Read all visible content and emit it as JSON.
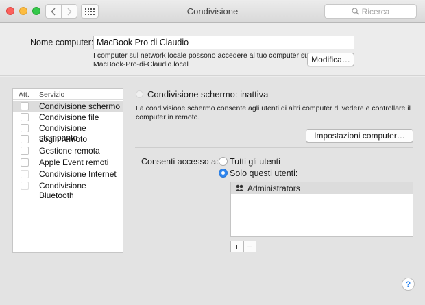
{
  "window": {
    "title": "Condivisione",
    "search_placeholder": "Ricerca"
  },
  "computer_name": {
    "label": "Nome computer:",
    "value": "MacBook Pro di Claudio",
    "info_line1": "I computer sul network locale possono accedere al tuo computer su:",
    "info_line2": "MacBook-Pro-di-Claudio.local",
    "edit_button": "Modifica…"
  },
  "services": {
    "col_on": "Att.",
    "col_service": "Servizio",
    "items": [
      {
        "label": "Condivisione schermo",
        "checked": false,
        "selected": true
      },
      {
        "label": "Condivisione file",
        "checked": false,
        "selected": false
      },
      {
        "label": "Condivisione stampante",
        "checked": false,
        "selected": false
      },
      {
        "label": "Login remoto",
        "checked": false,
        "selected": false
      },
      {
        "label": "Gestione remota",
        "checked": false,
        "selected": false
      },
      {
        "label": "Apple Event remoti",
        "checked": false,
        "selected": false
      },
      {
        "label": "Condivisione Internet",
        "checked": false,
        "selected": false
      },
      {
        "label": "Condivisione Bluetooth",
        "checked": false,
        "selected": false
      }
    ]
  },
  "detail": {
    "status_title": "Condivisione schermo: inattiva",
    "desc_line1": "La condivisione schermo consente agli utenti di altri computer di vedere e controllare il",
    "desc_line2": "computer in remoto.",
    "settings_button": "Impostazioni computer…",
    "access_label": "Consenti accesso a:",
    "option_all": "Tutti gli utenti",
    "option_only": "Solo questi utenti:",
    "selected_option": "only",
    "users": [
      "Administrators"
    ],
    "add_label": "+",
    "remove_label": "−"
  },
  "help_label": "?",
  "colors": {
    "accent": "#2f86ef",
    "selected_row": "#dcdcdc"
  }
}
